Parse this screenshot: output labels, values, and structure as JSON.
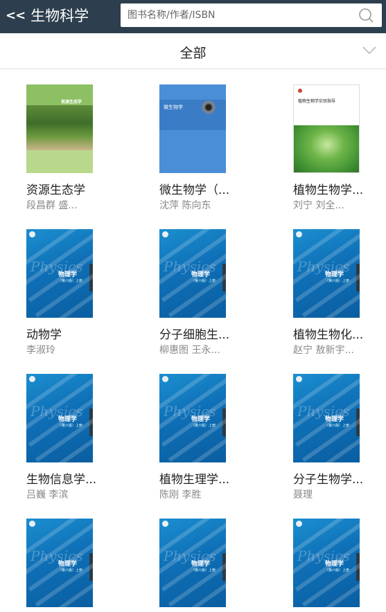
{
  "header": {
    "back_icon": "<<",
    "title": "生物科学",
    "search_placeholder": "图书名称/作者/ISBN",
    "search_icon": "search-icon",
    "background": "#2d3f4e"
  },
  "filter": {
    "label": "全部",
    "chevron_icon": "chevron-down-icon"
  },
  "books": [
    {
      "title": "资源生态学",
      "author": "段昌群 盛...",
      "cover": "ecology",
      "cover_text": "资源生态学"
    },
    {
      "title": "微生物学（...",
      "author": "沈萍 陈向东",
      "cover": "micro",
      "cover_text": "微生物学"
    },
    {
      "title": "植物生物学...",
      "author": "刘宁 刘全...",
      "cover": "plantlab",
      "cover_text": "植物生物学实验指导"
    },
    {
      "title": "动物学",
      "author": "李淑玲",
      "cover": "physics",
      "cover_text": "物理学"
    },
    {
      "title": "分子细胞生...",
      "author": "柳惠图 王永...",
      "cover": "physics",
      "cover_text": "物理学"
    },
    {
      "title": "植物生物化...",
      "author": "赵宁 敖新宇...",
      "cover": "physics",
      "cover_text": "物理学"
    },
    {
      "title": "生物信息学...",
      "author": "吕巍 李滨",
      "cover": "physics",
      "cover_text": "物理学"
    },
    {
      "title": "植物生理学...",
      "author": "陈刚 李胜",
      "cover": "physics",
      "cover_text": "物理学"
    },
    {
      "title": "分子生物学...",
      "author": "聂理",
      "cover": "physics",
      "cover_text": "物理学"
    },
    {
      "title": "",
      "author": "",
      "cover": "physics",
      "cover_text": "物理学"
    },
    {
      "title": "",
      "author": "",
      "cover": "physics",
      "cover_text": "物理学"
    },
    {
      "title": "",
      "author": "",
      "cover": "physics",
      "cover_text": "物理学"
    }
  ]
}
